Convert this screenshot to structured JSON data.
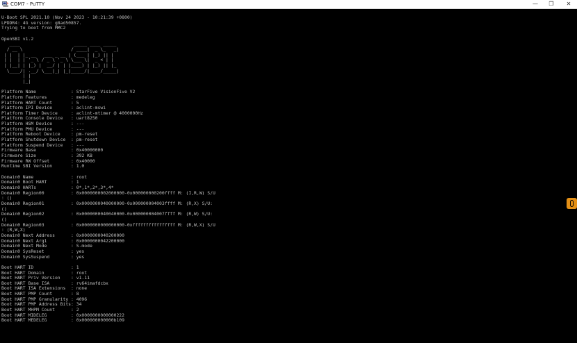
{
  "window": {
    "title": "COM7 - PuTTY",
    "minimize_glyph": "—",
    "maximize_glyph": "❐",
    "close_glyph": "✕",
    "app_icon": "putty-computer-icon"
  },
  "colors": {
    "terminal_background": "#000000",
    "terminal_text": "#bfbfbf",
    "titlebar": "#ffffff",
    "scroll_thumb": "#e38f16"
  },
  "terminal": {
    "lines": [
      "U-Boot SPL 2021.10 (Nov 24 2023 - 10:21:39 +0800)",
      "LPDDR4: 4G version: g8ad50857.",
      "Trying to boot from MMC2",
      "",
      "OpenSBI v1.2",
      "   ____                    _____ ____ _____",
      "  / __ \\                  / ____|  _ \\_   _|",
      " | |  | |_ __   ___ _ __ | (___ | |_) || |",
      " | |  | | '_ \\ / _ \\ '_ \\ \\___ \\|  _ < | |",
      " | |__| | |_) |  __/ | | |____) | |_) || |_",
      "  \\____/| .__/ \\___|_| |_|_____/|____/_____|",
      "        | |",
      "        |_|",
      "",
      "Platform Name             : StarFive VisionFive V2",
      "Platform Features         : medeleg",
      "Platform HART Count       : 5",
      "Platform IPI Device       : aclint-mswi",
      "Platform Timer Device     : aclint-mtimer @ 4000000Hz",
      "Platform Console Device   : uart8250",
      "Platform HSM Device       : ---",
      "Platform PMU Device       : ---",
      "Platform Reboot Device    : pm-reset",
      "Platform Shutdown Device  : pm-reset",
      "Platform Suspend Device   : ---",
      "Firmware Base             : 0x40000000",
      "Firmware Size             : 392 KB",
      "Firmware RW Offset        : 0x40000",
      "Runtime SBI Version       : 1.0",
      "",
      "Domain0 Name              : root",
      "Domain0 Boot HART         : 1",
      "Domain0 HARTs             : 0*,1*,2*,3*,4*",
      "Domain0 Region00          : 0x0000000002000000-0x000000000200ffff M: (I,R,W) S/U",
      ": ()",
      "Domain0 Region01          : 0x0000000040000000-0x000000004003ffff M: (R,X) S/U:",
      "()",
      "Domain0 Region02          : 0x0000000040040000-0x000000004007ffff M: (R,W) S/U:",
      "()",
      "Domain0 Region03          : 0x0000000000000000-0xffffffffffffffff M: (R,W,X) S/U",
      ": (R,W,X)",
      "Domain0 Next Address      : 0x0000000040200000",
      "Domain0 Next Arg1         : 0x0000000042200000",
      "Domain0 Next Mode         : S-mode",
      "Domain0 SysReset          : yes",
      "Domain0 SysSuspend        : yes",
      "",
      "Boot HART ID              : 1",
      "Boot HART Domain          : root",
      "Boot HART Priv Version    : v1.11",
      "Boot HART Base ISA        : rv64imafdcbx",
      "Boot HART ISA Extensions  : none",
      "Boot HART PMP Count       : 8",
      "Boot HART PMP Granularity : 4096",
      "Boot HART PMP Address Bits: 34",
      "Boot HART MHPM Count      : 2",
      "Boot HART MIDELEG         : 0x0000000000000222",
      "Boot HART MEDELEG         : 0x000000000000b109"
    ]
  }
}
